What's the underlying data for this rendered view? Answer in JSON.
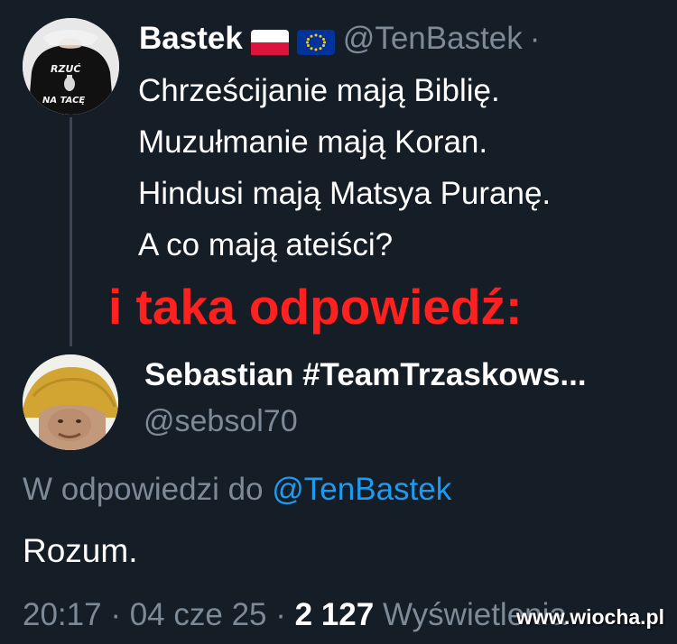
{
  "tweet": {
    "author_name": "Bastek",
    "flags": [
      "flag-poland-icon",
      "flag-eu-icon"
    ],
    "handle": "@TenBastek",
    "separator": "·",
    "avatar_shirt_text": [
      "RZUĆ",
      "NA TACĘ"
    ],
    "lines": [
      "Chrześcijanie mają Biblię.",
      "Muzułmanie mają Koran.",
      "Hindusi mają Matsya Puranę.",
      "A co mają ateiści?"
    ]
  },
  "overlay_caption": "i taka odpowiedź:",
  "reply": {
    "author_name": "Sebastian #TeamTrzaskows...",
    "handle": "@sebsol70",
    "reply_to_label": "W odpowiedzi do",
    "reply_to_handle": "@TenBastek",
    "text": "Rozum.",
    "time": "20:17",
    "date": "04 cze 25",
    "separator": "·",
    "views_count": "2 127",
    "views_label": "Wyświetlenia"
  },
  "watermark": "www.wiocha.pl",
  "colors": {
    "background": "#151d27",
    "text": "#ffffff",
    "muted": "#7d8a98",
    "link": "#1d9bf0",
    "caption": "#ff2020"
  }
}
